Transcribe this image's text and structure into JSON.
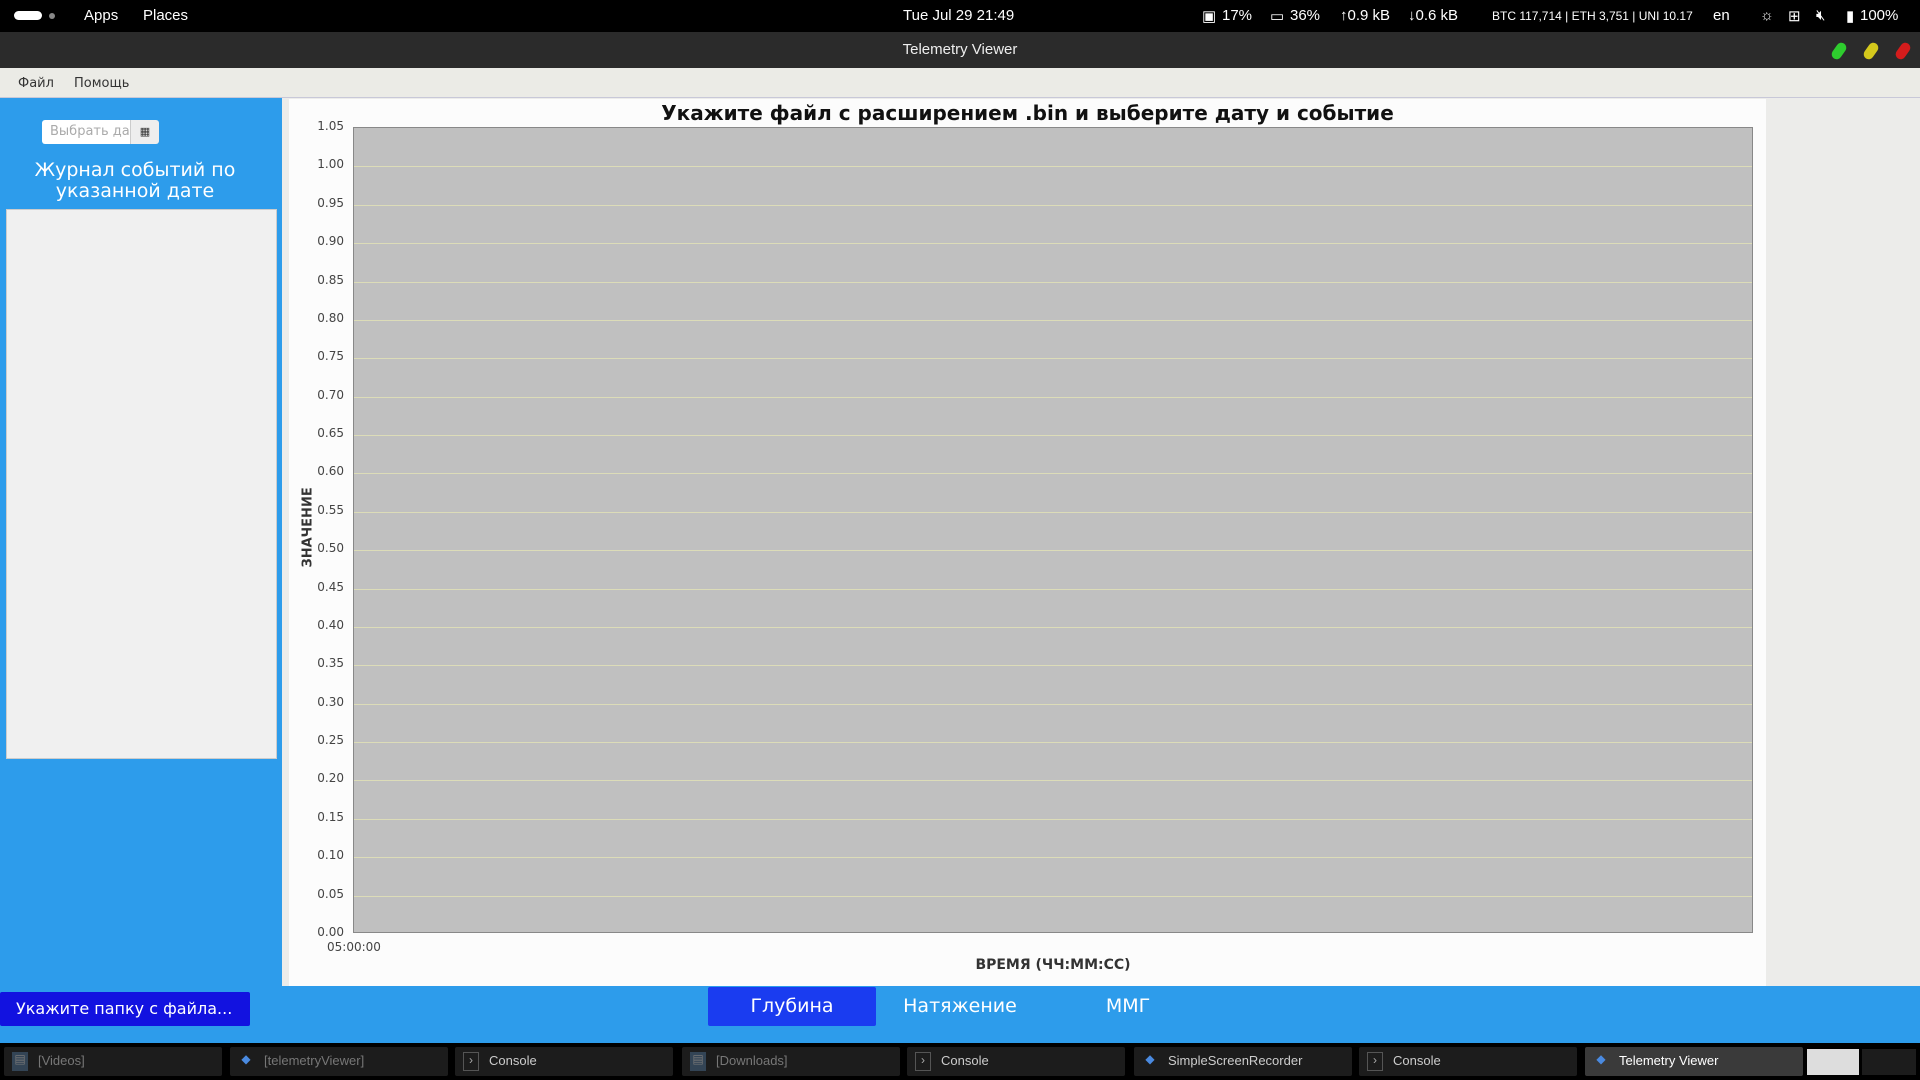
{
  "topbar": {
    "apps": "Apps",
    "places": "Places",
    "clock": "Tue Jul 29  21:49",
    "cpu": "17%",
    "mem": "36%",
    "up": "↑0.9 kB",
    "down": "↓0.6 kB",
    "crypto": "BTC 117,714 | ETH 3,751 | UNI 10.17",
    "lang": "en",
    "battery": "100%"
  },
  "window": {
    "title": "Telemetry Viewer"
  },
  "menu": {
    "file": "Файл",
    "help": "Помощь"
  },
  "sidebar": {
    "date_placeholder": "Выбрать дату",
    "log_title": "Журнал событий по указанной дате"
  },
  "chart_data": {
    "type": "line",
    "title": "Укажите файл с расширением .bin и выберите дату и событие",
    "xlabel": "ВРЕМЯ (ЧЧ:ММ:СС)",
    "ylabel": "ЗНАЧЕНИЕ",
    "ylim": [
      0,
      1.05
    ],
    "yticks": [
      "0.00",
      "0.05",
      "0.10",
      "0.15",
      "0.20",
      "0.25",
      "0.30",
      "0.35",
      "0.40",
      "0.45",
      "0.50",
      "0.55",
      "0.60",
      "0.65",
      "0.70",
      "0.75",
      "0.80",
      "0.85",
      "0.90",
      "0.95",
      "1.00",
      "1.05"
    ],
    "xticks": [
      "05:00:00"
    ],
    "series": [],
    "grid": true
  },
  "bottom": {
    "folder_button": "Укажите папку с файла...",
    "tabs": [
      "Глубина",
      "Натяжение",
      "ММГ"
    ],
    "active_tab": 0
  },
  "taskbar": {
    "items": [
      {
        "label": "[Videos]",
        "icon": "folder-icon"
      },
      {
        "label": "[telemetryViewer]",
        "icon": "java-icon"
      },
      {
        "label": "Console",
        "icon": "terminal-icon"
      },
      {
        "label": "[Downloads]",
        "icon": "folder-icon"
      },
      {
        "label": "Console",
        "icon": "terminal-icon"
      },
      {
        "label": "SimpleScreenRecorder",
        "icon": "java-icon"
      },
      {
        "label": "Console",
        "icon": "terminal-icon"
      },
      {
        "label": "Telemetry Viewer",
        "icon": "java-icon"
      }
    ]
  },
  "colors": {
    "accent": "#2d9ceb",
    "active_tab": "#1a3cf0",
    "folder_button": "#1212e0",
    "plot_bg": "#c0c0c0"
  }
}
